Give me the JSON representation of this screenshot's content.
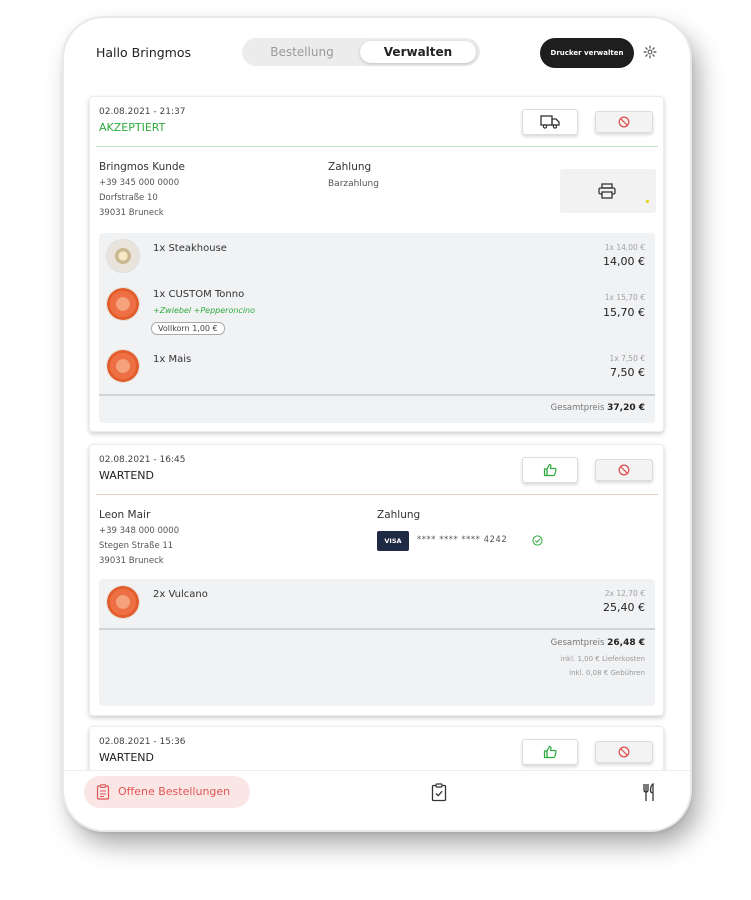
{
  "header": {
    "greeting": "Hallo Bringmos",
    "tabs": [
      {
        "label": "Bestellung",
        "active": false
      },
      {
        "label": "Verwalten",
        "active": true
      }
    ],
    "printer_button": "Drucker verwalten",
    "settings_icon": "gear-icon"
  },
  "orders": [
    {
      "datetime": "02.08.2021 - 21:37",
      "status": "AKZEPTIERT",
      "status_color": "#2eaa3e",
      "customer": {
        "name": "Bringmos Kunde",
        "phone": "+39 345 000 0000",
        "street": "Dorfstraße 10",
        "city": "39031 Bruneck"
      },
      "payment": {
        "label": "Zahlung",
        "method": "Barzahlung"
      },
      "items": [
        {
          "name": "1x Steakhouse",
          "unit": "1x 14,00 €",
          "total": "14,00 €"
        },
        {
          "name": "1x CUSTOM Tonno",
          "extras": "+Zwiebel +Pepperoncino",
          "tag": "Vollkorn 1,00 €",
          "unit": "1x 15,70 €",
          "total": "15,70 €"
        },
        {
          "name": "1x Mais",
          "unit": "1x 7,50 €",
          "total": "7,50 €"
        }
      ],
      "total_label": "Gesamtpreis",
      "total": "37,20 €"
    },
    {
      "datetime": "02.08.2021 - 16:45",
      "status": "WARTEND",
      "customer": {
        "name": "Leon Mair",
        "phone": "+39 348 000 0000",
        "street": "Stegen Straße 11",
        "city": "39031 Bruneck"
      },
      "payment": {
        "label": "Zahlung",
        "card_brand": "VISA",
        "card_number": "**** **** **** 4242"
      },
      "items": [
        {
          "name": "2x Vulcano",
          "unit": "2x 12,70 €",
          "total": "25,40 €"
        }
      ],
      "total_label": "Gesamtpreis",
      "total": "26,48 €",
      "delivery_note": "inkl. 1,00 € Lieferkosten",
      "fee_note": "inkl. 0,08 € Gebühren"
    },
    {
      "datetime": "02.08.2021 - 15:36",
      "status": "WARTEND"
    }
  ],
  "bottom_nav": {
    "active_label": "Offene Bestellungen",
    "items": [
      "open-orders-icon",
      "clipboard-check-icon",
      "cutlery-icon"
    ]
  }
}
